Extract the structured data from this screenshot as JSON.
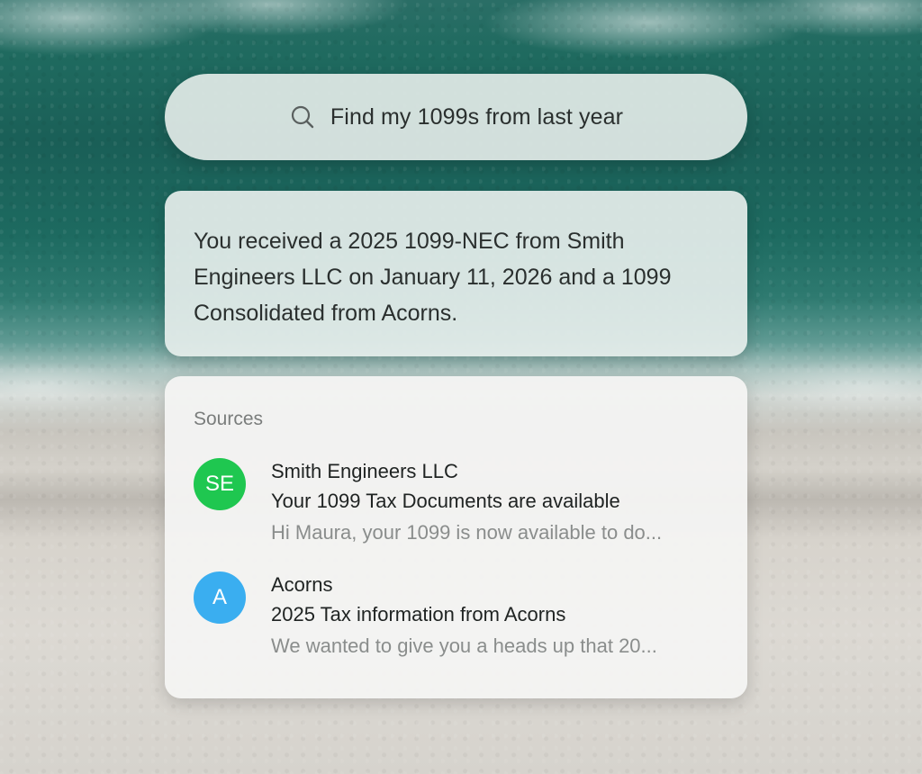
{
  "search": {
    "query": "Find my 1099s from last year",
    "icon": "search-icon"
  },
  "answer": {
    "text": "You received a 2025 1099-NEC from Smith Engineers LLC on January 11, 2026 and a 1099 Consolidated from Acorns."
  },
  "sources": {
    "heading": "Sources",
    "items": [
      {
        "initials": "SE",
        "avatar_color": "#1fc750",
        "sender": "Smith Engineers LLC",
        "subject": "Your 1099 Tax Documents are available",
        "preview": "Hi Maura, your 1099 is now available to do..."
      },
      {
        "initials": "A",
        "avatar_color": "#3aaef0",
        "sender": "Acorns",
        "subject": "2025 Tax information from Acorns",
        "preview": "We wanted to give you a heads up that 20..."
      }
    ]
  }
}
